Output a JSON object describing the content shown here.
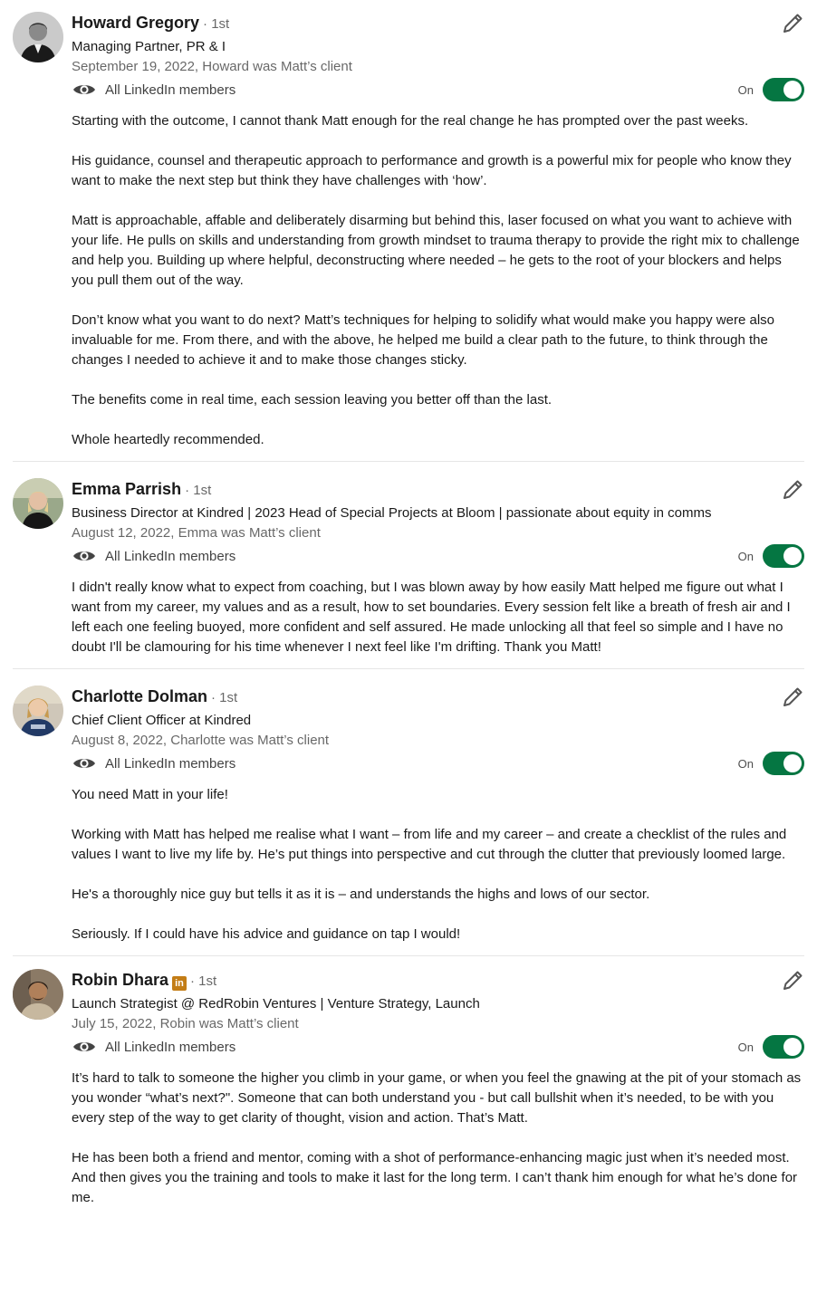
{
  "recommendations": [
    {
      "name": "Howard Gregory",
      "badge": "",
      "degree": "· 1st",
      "headline": "Managing Partner, PR & I",
      "date": "September 19, 2022, Howard was Matt’s client",
      "visibility": "All LinkedIn members",
      "toggle_label": "On",
      "paragraphs": [
        "Starting with the outcome, I cannot thank Matt enough for the real change he has prompted over the past weeks.",
        "His guidance, counsel and therapeutic approach to performance and growth is a powerful mix for people who know they want to make the next step but think they have challenges with ‘how’.",
        "Matt is approachable, affable and deliberately disarming but behind this, laser focused on what you want to achieve with your life. He pulls on skills and understanding from growth mindset to trauma therapy to provide the right mix to challenge and help you. Building up where helpful, deconstructing where needed – he gets to the root of your blockers and helps you pull them out of the way.",
        "Don’t know what you want to do next? Matt’s techniques for helping to solidify what would make you happy were also invaluable for me. From there, and with the above, he helped me build a clear path to the future, to think through the changes I needed to achieve it and to make those changes sticky.",
        "The benefits come in real time, each session leaving you better off than the last.",
        "Whole heartedly recommended."
      ]
    },
    {
      "name": "Emma Parrish",
      "badge": "",
      "degree": "· 1st",
      "headline": "Business Director at Kindred | 2023 Head of Special Projects at Bloom | passionate about equity in comms",
      "date": "August 12, 2022, Emma was Matt’s client",
      "visibility": "All LinkedIn members",
      "toggle_label": "On",
      "paragraphs": [
        "I didn't really know what to expect from coaching, but I was blown away by how easily Matt helped me figure out what I want from my career, my values and as a result, how to set boundaries. Every session felt like a breath of fresh air and I left each one feeling buoyed, more confident and self assured. He made unlocking all that feel so simple and I have no doubt I'll be clamouring for his time whenever I next feel like I'm drifting. Thank you Matt!"
      ]
    },
    {
      "name": "Charlotte Dolman",
      "badge": "",
      "degree": "· 1st",
      "headline": "Chief Client Officer at Kindred",
      "date": "August 8, 2022, Charlotte was Matt’s client",
      "visibility": "All LinkedIn members",
      "toggle_label": "On",
      "paragraphs": [
        "You need Matt in your life!",
        "Working with Matt has helped me realise what I want – from life and my career – and create a checklist of the rules and values I want to live my life by. He’s put things into perspective and cut through the clutter that previously loomed large.",
        "He's a thoroughly nice guy but tells it as it is – and understands the highs and lows of our sector.",
        "Seriously. If I could have his advice and guidance on tap I would!"
      ]
    },
    {
      "name": "Robin Dhara",
      "badge": "in",
      "degree": "· 1st",
      "headline": "Launch Strategist @ RedRobin Ventures | Venture Strategy, Launch",
      "date": "July 15, 2022, Robin was Matt’s client",
      "visibility": "All LinkedIn members",
      "toggle_label": "On",
      "paragraphs": [
        "It’s hard to talk to someone the higher you climb in your game, or when you feel the gnawing at the pit of your stomach as you wonder “what’s next?\". Someone that can both understand you - but call bullshit when it’s needed, to be with you every step of the way to get clarity of thought, vision and action. That’s Matt.",
        "He has been both a friend and mentor, coming with a shot of performance-enhancing magic just when it’s needed most. And then gives you the training and tools to make it last for the long term. I can’t thank him enough for what he’s done for me."
      ]
    }
  ],
  "colors": {
    "toggle_on": "#057642",
    "premium_badge": "#c37d16",
    "divider": "#e6e6e6"
  },
  "icons": {
    "edit": "pencil-icon",
    "visibility": "eye-icon"
  }
}
